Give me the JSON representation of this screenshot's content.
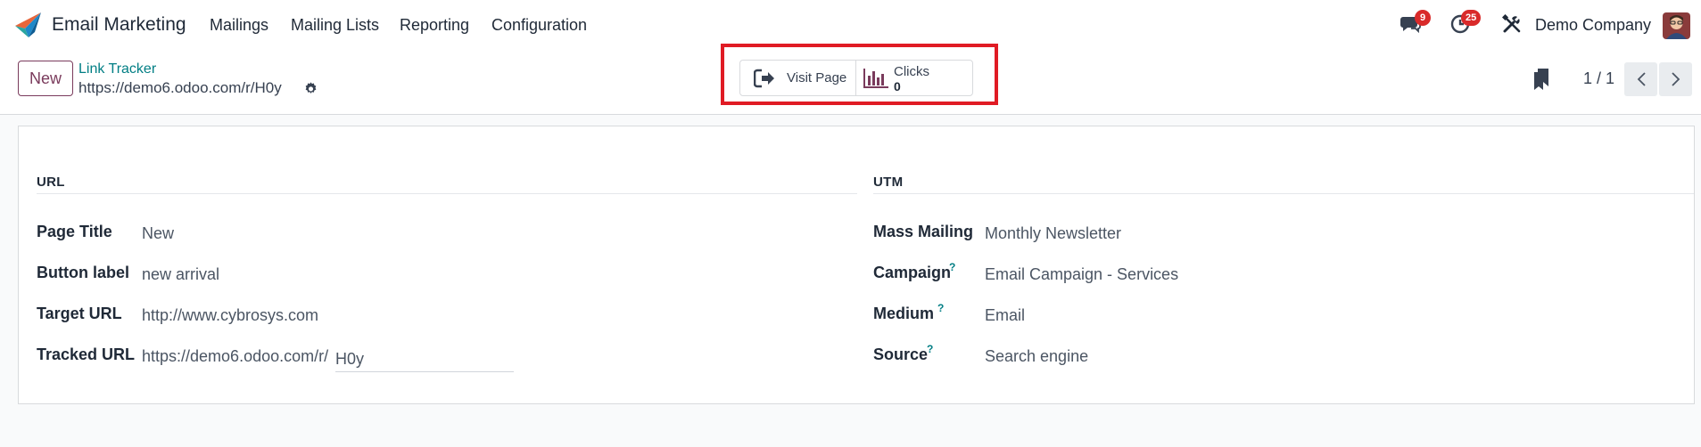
{
  "app": {
    "name": "Email Marketing"
  },
  "menu": {
    "mailings": "Mailings",
    "mailing_lists": "Mailing Lists",
    "reporting": "Reporting",
    "configuration": "Configuration"
  },
  "systray": {
    "messages_count": "9",
    "activities_count": "25",
    "company": "Demo Company"
  },
  "control_panel": {
    "new_label": "New",
    "breadcrumb": "Link Tracker",
    "record_name": "https://demo6.odoo.com/r/H0y",
    "pager": "1 / 1"
  },
  "smart_buttons": {
    "visit_page": "Visit Page",
    "clicks_label": "Clicks",
    "clicks_value": "0"
  },
  "form": {
    "url_section": "URL",
    "utm_section": "UTM",
    "page_title_label": "Page Title",
    "page_title_value": "New",
    "button_label_label": "Button label",
    "button_label_value": "new arrival",
    "target_url_label": "Target URL",
    "target_url_value": "http://www.cybrosys.com",
    "tracked_url_label": "Tracked URL",
    "tracked_url_prefix": "https://demo6.odoo.com/r/",
    "tracked_url_code": "H0y",
    "mass_mailing_label": "Mass Mailing",
    "mass_mailing_value": "Monthly Newsletter",
    "campaign_label": "Campaign",
    "campaign_value": "Email Campaign - Services",
    "medium_label": "Medium",
    "medium_value": "Email",
    "source_label": "Source",
    "source_value": "Search engine",
    "help_mark": "?"
  },
  "colors": {
    "brand": "#7a3b5c",
    "link": "#017e84",
    "badge": "#d92a2a",
    "highlight": "#e01b24"
  }
}
